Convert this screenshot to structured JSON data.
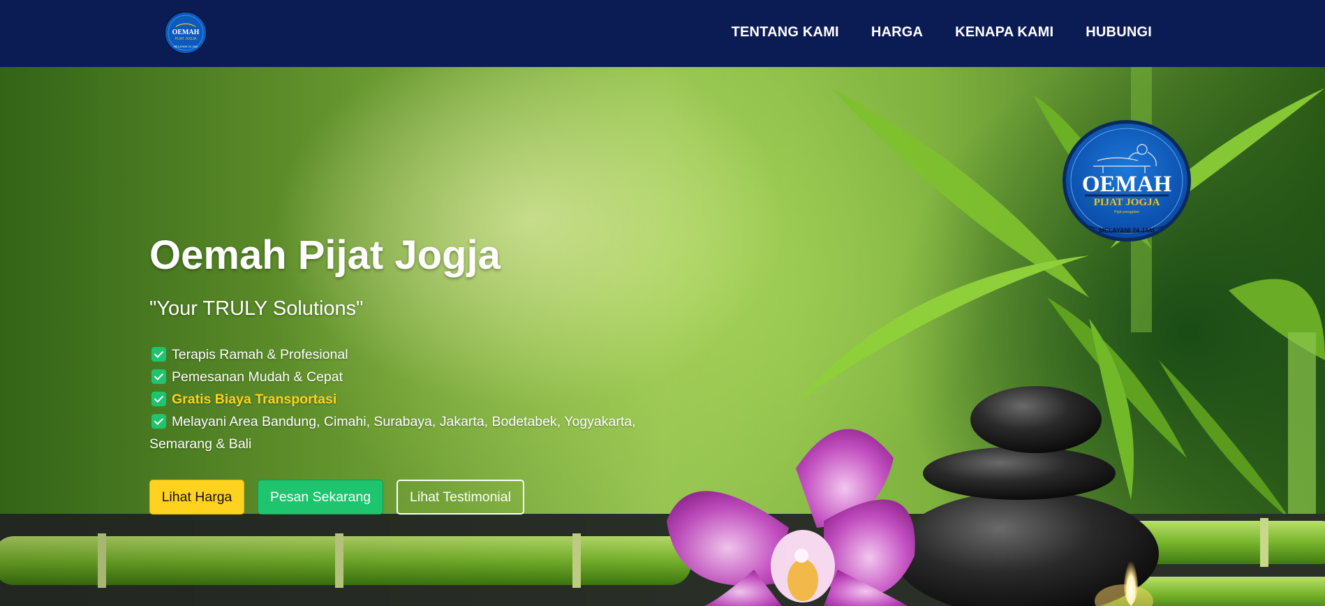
{
  "brand": {
    "logo_text": "OEMAH",
    "logo_subtext": "PIJAT JOGJA",
    "logo_tagline": "Pijat panggilan",
    "logo_service": "MELAYANI 24 JAM",
    "colors": {
      "navy": "#0b1c55",
      "logo_blue": "#0a5bbd",
      "gold": "#f2c31b"
    }
  },
  "nav": {
    "links": [
      {
        "label": "TENTANG KAMI"
      },
      {
        "label": "HARGA"
      },
      {
        "label": "KENAPA KAMI"
      },
      {
        "label": "HUBUNGI"
      }
    ]
  },
  "hero": {
    "title": "Oemah Pijat Jogja",
    "tagline": "\"Your TRULY Solutions\"",
    "features": [
      {
        "text": "Terapis Ramah & Profesional"
      },
      {
        "text": "Pemesanan Mudah & Cepat"
      },
      {
        "text": "Gratis Biaya Transportasi",
        "highlight": true
      },
      {
        "text": "Melayani Area Bandung, Cimahi, Surabaya, Jakarta, Bodetabek, Yogyakarta, Semarang & Bali"
      }
    ],
    "buttons": {
      "price": "Lihat Harga",
      "order": "Pesan Sekarang",
      "testimonial": "Lihat Testimonial"
    },
    "colors": {
      "check": "#1fc46f",
      "highlight": "#ffd21f",
      "button_yellow": "#ffd21f",
      "button_green": "#1fc46f"
    }
  }
}
